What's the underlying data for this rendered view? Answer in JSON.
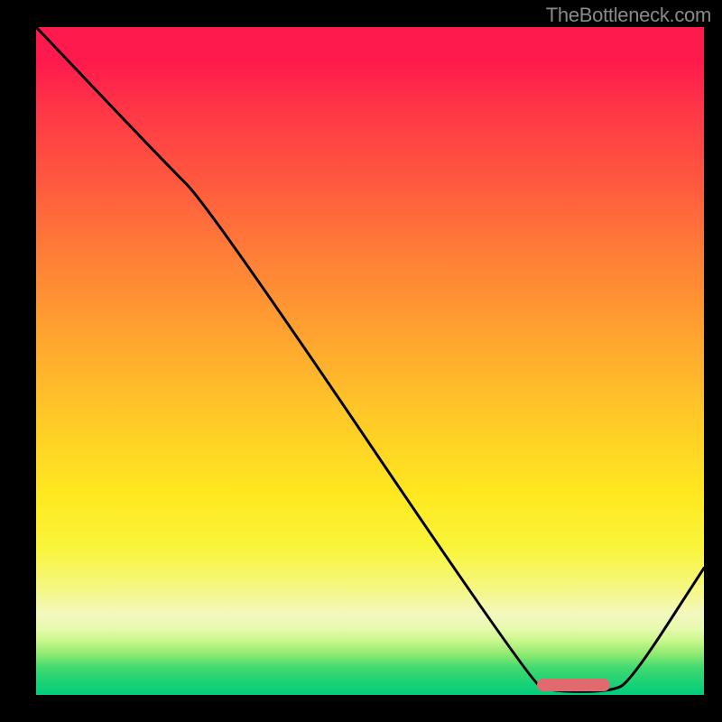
{
  "watermark": "TheBottleneck.com",
  "chart_data": {
    "type": "line",
    "title": "",
    "xlabel": "",
    "ylabel": "",
    "xlim": [
      0,
      100
    ],
    "ylim": [
      0,
      100
    ],
    "gradient_bands": [
      {
        "pos": 0,
        "color": "#ff1a4d"
      },
      {
        "pos": 33,
        "color": "#ff7a38"
      },
      {
        "pos": 70,
        "color": "#ffe820"
      },
      {
        "pos": 100,
        "color": "#00cc7a"
      }
    ],
    "curve": [
      {
        "x": 0,
        "y": 100
      },
      {
        "x": 19,
        "y": 80
      },
      {
        "x": 26,
        "y": 73
      },
      {
        "x": 74,
        "y": 2
      },
      {
        "x": 77,
        "y": 0.5
      },
      {
        "x": 86,
        "y": 0.5
      },
      {
        "x": 89,
        "y": 2
      },
      {
        "x": 100,
        "y": 19
      }
    ],
    "marker": {
      "x_start": 75,
      "x_end": 86,
      "y": 1.5
    }
  }
}
